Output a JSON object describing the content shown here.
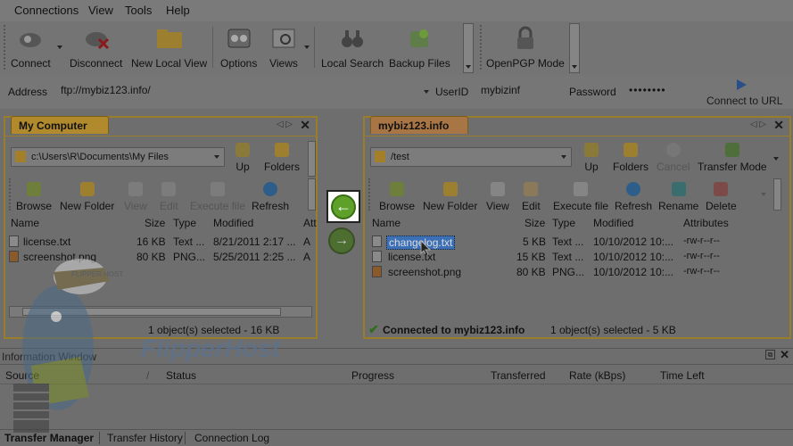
{
  "menu": [
    "Connections",
    "View",
    "Tools",
    "Help"
  ],
  "toolbar": {
    "buttons": [
      "Connect",
      "Disconnect",
      "New Local View",
      "Options",
      "Views",
      "Local Search",
      "Backup Files",
      "OpenPGP Mode"
    ]
  },
  "address_bar": {
    "address_label": "Address",
    "address_value": "ftp://mybiz123.info/",
    "userid_label": "UserID",
    "userid_value": "mybizinf",
    "password_label": "Password",
    "password_value": "••••••••",
    "connect_url_label": "Connect to URL"
  },
  "left_panel": {
    "tab_title": "My Computer",
    "path": "c:\\Users\\R\\Documents\\My Files",
    "up_label": "Up",
    "folders_label": "Folders",
    "actions": [
      "Browse",
      "New Folder",
      "View",
      "Edit",
      "Execute file",
      "Refresh"
    ],
    "columns": [
      "Name",
      "Size",
      "Type",
      "Modified",
      "Att"
    ],
    "files": [
      {
        "name": "license.txt",
        "size": "16 KB",
        "type": "Text ...",
        "modified": "8/21/2011 2:17 ...",
        "attr": "A"
      },
      {
        "name": "screenshot.png",
        "size": "80 KB",
        "type": "PNG...",
        "modified": "5/25/2011 2:25 ...",
        "attr": "A"
      }
    ],
    "status": "1 object(s) selected - 16 KB"
  },
  "right_panel": {
    "tab_title": "mybiz123.info",
    "path": "/test",
    "up_label": "Up",
    "folders_label": "Folders",
    "cancel_label": "Cancel",
    "transfer_mode_label": "Transfer Mode",
    "actions": [
      "Browse",
      "New Folder",
      "View",
      "Edit",
      "Execute file",
      "Refresh",
      "Rename",
      "Delete"
    ],
    "columns": [
      "Name",
      "Size",
      "Type",
      "Modified",
      "Attributes"
    ],
    "files": [
      {
        "name": "changelog.txt",
        "size": "5 KB",
        "type": "Text ...",
        "modified": "10/10/2012 10:...",
        "attr": "-rw-r--r--"
      },
      {
        "name": "license.txt",
        "size": "15 KB",
        "type": "Text ...",
        "modified": "10/10/2012 10:...",
        "attr": "-rw-r--r--"
      },
      {
        "name": "screenshot.png",
        "size": "80 KB",
        "type": "PNG...",
        "modified": "10/10/2012 10:...",
        "attr": "-rw-r--r--"
      }
    ],
    "connected_status": "Connected to mybiz123.info",
    "status": "1 object(s) selected - 5 KB"
  },
  "info_window": {
    "title": "Information Window",
    "columns": [
      "Source",
      "/",
      "Status",
      "Progress",
      "Transferred",
      "Rate (kBps)",
      "Time Left"
    ],
    "tabs": [
      "Transfer Manager",
      "Transfer History",
      "Connection Log"
    ]
  },
  "mascot": {
    "cap_text": "FLIPPER HOST",
    "logo_text": "FlipperHost"
  },
  "colors": {
    "accent": "#5ea12a",
    "panel_border": "#9a7d2b",
    "selection": "#3b6fb6"
  }
}
